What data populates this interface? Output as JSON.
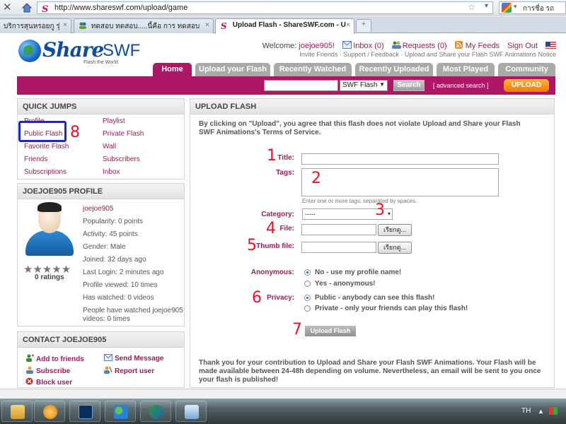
{
  "browser": {
    "url": "http://www.shareswf.com/upload/game",
    "search_engine_text": "การชื่อ รถ",
    "tabs": [
      {
        "label": "บริการสุนหรอยกู รุ่งอ..."
      },
      {
        "label": "ทดสอบ ทดสอบ.....นี้คือ การ ทดสอบ"
      },
      {
        "label": "Upload Flash - ShareSWF.com - U..."
      }
    ],
    "new_tab": "+"
  },
  "site": {
    "logo_share": "Share",
    "logo_swf": "SWF",
    "logo_tagline": "Flash the World",
    "welcome_prefix": "Welcome: ",
    "username": "joejoe905!",
    "inbox": "Inbox (0)",
    "requests": "Requests (0)",
    "my_feeds": "My Feeds",
    "sign_out": "Sign Out",
    "sublinks": "Invite Friends · Support / Feedback · Upload and Share your Flash SWF Animations Notice",
    "nav": [
      "Home",
      "Upload your Flash",
      "Recently Watched",
      "Recently Uploaded",
      "Most Played",
      "Community"
    ],
    "search_select": "SWF Flash",
    "search_button": "Search",
    "advanced_search": "[ advanced search ]",
    "upload_button": "UPLOAD"
  },
  "quick_jumps": {
    "title": "QUICK JUMPS",
    "left": [
      "Profile",
      "Public Flash",
      "Favorite Flash",
      "Friends",
      "Subscriptions"
    ],
    "right": [
      "Playlist",
      "Private Flash",
      "Wall",
      "Subscribers",
      "Inbox"
    ]
  },
  "profile": {
    "title": "JOEJOE905 PROFILE",
    "username": "joejoe905",
    "stars": "★★★★★",
    "ratings": "0 ratings",
    "info": [
      "Popularity: 0 points",
      "Activity: 45 points",
      "Gender: Male",
      "Joined: 32 days ago",
      "Last Login: 2 minutes ago",
      "Profile viewed: 10 times",
      "Has watched: 0 videos",
      "People have watched joejoe905",
      "videos: 0 times"
    ]
  },
  "contact": {
    "title": "CONTACT JOEJOE905",
    "add_friends": "Add to friends",
    "send_message": "Send Message",
    "subscribe": "Subscribe",
    "report_user": "Report user",
    "block_user": "Block user"
  },
  "upload": {
    "title": "UPLOAD FLASH",
    "intro": "By clicking on \"Upload\", you agree that this flash does not violate Upload and Share your Flash SWF Animations's Terms of Service.",
    "title_label": "Title:",
    "tags_label": "Tags:",
    "tags_hint": "Enter one or more tags, separated by spaces.",
    "category_label": "Category:",
    "category_value": "-----",
    "file_label": "File:",
    "thumb_label": "Thumb file:",
    "browse_label": "เรียกดู...",
    "anonymous_label": "Anonymous:",
    "anon_no": "No - use my profile name!",
    "anon_yes": "Yes - anonymous!",
    "privacy_label": "Privacy:",
    "privacy_public": "Public - anybody can see this flash!",
    "privacy_private": "Private - only your friends can play this flash!",
    "submit": "Upload Flash",
    "thanks": "Thank you for your contribution to Upload and Share your Flash SWF Animations. Your Flash will be made available between 24-48h depending on volume. Nevertheless, an email will be sent to you once your flash is published!"
  },
  "annotations": [
    "1",
    "2",
    "3",
    "4",
    "5",
    "6",
    "7",
    "8"
  ],
  "taskbar": {
    "lang": "TH",
    "tray_arrow": "▲"
  },
  "colors": {
    "brand": "#ac1766",
    "link": "#a3185a",
    "upload_orange": "#f07b00",
    "annotation_red": "#e8102a",
    "highlight_blue": "#1826cf"
  }
}
